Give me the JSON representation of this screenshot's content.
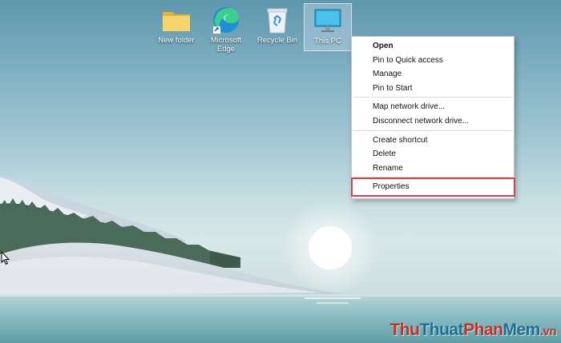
{
  "desktop": {
    "icons": [
      {
        "name": "folder-icon",
        "label": "New folder"
      },
      {
        "name": "edge-icon",
        "label": "Microsoft\nEdge"
      },
      {
        "name": "recycle-bin-icon",
        "label": "Recycle Bin"
      },
      {
        "name": "monitor-icon",
        "label": "This PC"
      }
    ]
  },
  "context_menu": {
    "groups": [
      [
        "Open",
        "Pin to Quick access",
        "Manage",
        "Pin to Start"
      ],
      [
        "Map network drive...",
        "Disconnect network drive..."
      ],
      [
        "Create shortcut",
        "Delete",
        "Rename"
      ],
      [
        "Properties"
      ]
    ],
    "default_item": "Open",
    "highlighted_item": "Properties",
    "highlight_color": "#d8434a"
  },
  "watermark": {
    "part1": "Thu",
    "part2": "Thuat",
    "part3": "Phan",
    "part4": "Mem",
    "part5": ".vn"
  }
}
